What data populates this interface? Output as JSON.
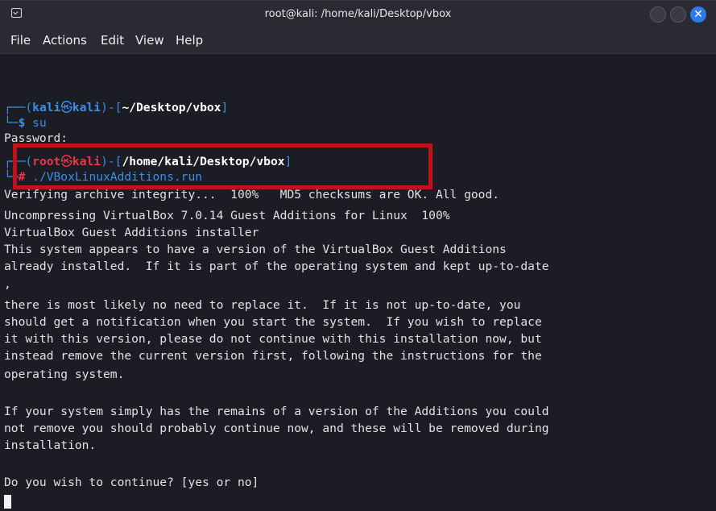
{
  "window": {
    "title": "root@kali: /home/kali/Desktop/vbox"
  },
  "menu": [
    "File",
    "Actions",
    "Edit",
    "View",
    "Help"
  ],
  "prompt1": {
    "corner_top": "┌──(",
    "user": "kali",
    "at": "㉿",
    "host": "kali",
    "mid": ")-[",
    "path": "~/Desktop/vbox",
    "end": "]",
    "corner_bottom": "└─",
    "symbol": "$",
    "command": " su"
  },
  "password_line": "Password:",
  "prompt2": {
    "corner_top": "┌──(",
    "user": "root",
    "at": "㉿",
    "host": "kali",
    "mid": ")-[",
    "path": "/home/kali/Desktop/vbox",
    "end": "]",
    "corner_bottom": "└─",
    "symbol": "#",
    "command": " ./VBoxLinuxAdditions.run"
  },
  "output": [
    "Verifying archive integrity...  100%   MD5 checksums are OK. All good.",
    "Uncompressing VirtualBox 7.0.14 Guest Additions for Linux  100%",
    "VirtualBox Guest Additions installer",
    "This system appears to have a version of the VirtualBox Guest Additions",
    "already installed.  If it is part of the operating system and kept up-to-date",
    ",",
    "there is most likely no need to replace it.  If it is not up-to-date, you",
    "should get a notification when you start the system.  If you wish to replace",
    "it with this version, please do not continue with this installation now, but",
    "instead remove the current version first, following the instructions for the",
    "operating system.",
    "",
    "If your system simply has the remains of a version of the Additions you could",
    "not remove you should probably continue now, and these will be removed during",
    "installation.",
    "",
    "Do you wish to continue? [yes or no]"
  ],
  "colors": {
    "prompt_blue": "#3b8eea",
    "root_red": "#e6394a",
    "highlight_box": "#c0121b",
    "close_button": "#2f79e8"
  }
}
